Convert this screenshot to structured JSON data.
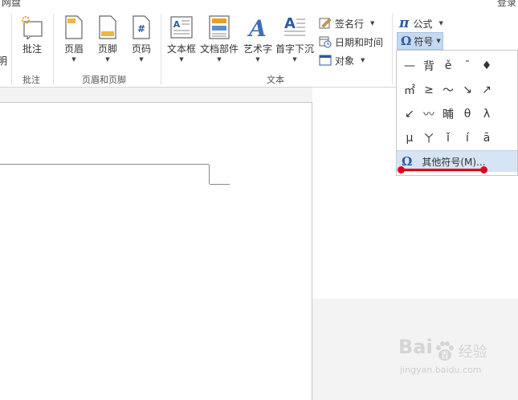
{
  "window": {
    "title": "网盘",
    "login": "登录"
  },
  "ribbon": {
    "left_cut_label": "明",
    "comment": {
      "button": "批注",
      "group": "批注"
    },
    "header_footer": {
      "header": "页眉",
      "footer": "页脚",
      "page_number": "页码",
      "group": "页眉和页脚"
    },
    "text": {
      "textbox": "文本框",
      "doc_parts": "文档部件",
      "wordart": "艺术字",
      "dropcap": "首字下沉",
      "signature": "签名行",
      "datetime": "日期和时间",
      "object": "对象",
      "group": "文本"
    },
    "symbols": {
      "equation": "公式",
      "symbol": "符号"
    }
  },
  "symbol_panel": {
    "symbols": [
      "—",
      "背",
      "ě",
      "¯",
      "♦",
      "",
      "㎡",
      "≥",
      "～",
      "↘",
      "↗",
      "",
      "↙",
      "〰",
      "晡",
      "θ",
      "λ",
      "",
      "μ",
      "ㄚ",
      "ǐ",
      "í",
      "ā",
      ""
    ],
    "more_label": "其他符号(M)..."
  },
  "watermark": {
    "brand": "Bai",
    "brand2": "百",
    "cn": "经验",
    "url": "jingyan.baidu.com"
  },
  "colors": {
    "accent": "#2d5c9e",
    "highlight": "#c5d9f1",
    "annotation": "#e0001a"
  }
}
